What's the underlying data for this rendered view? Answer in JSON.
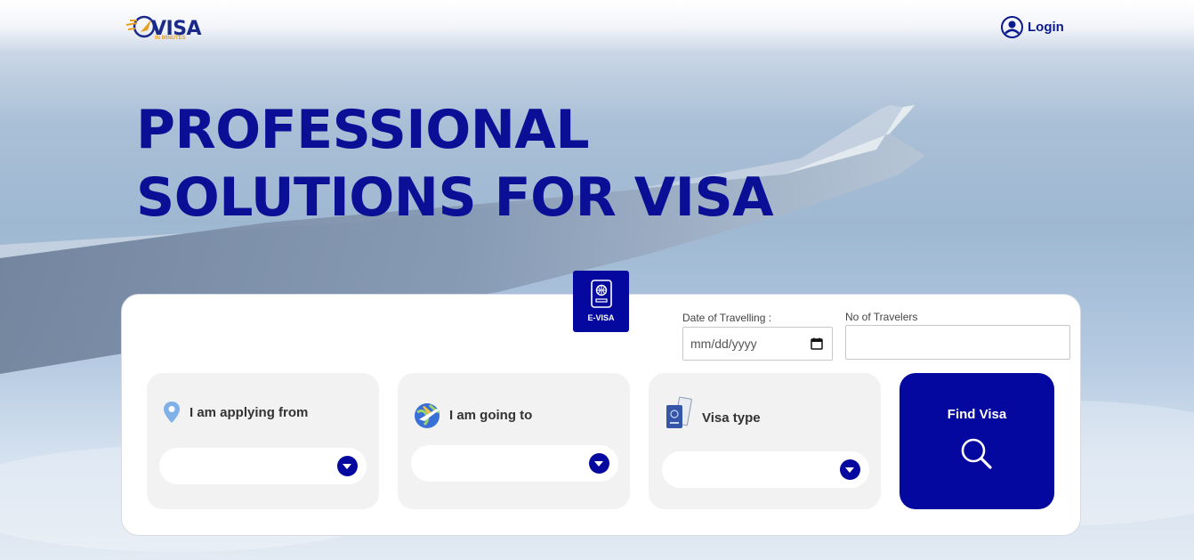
{
  "header": {
    "logo_text": "VISA",
    "logo_subtext": "IN MINUTES",
    "login_label": "Login"
  },
  "hero": {
    "line1": "PROFESSIONAL",
    "line2": "SOLUTIONS FOR VISA"
  },
  "search": {
    "tab_label": "E-VISA",
    "date_label": "Date of Travelling :",
    "date_placeholder": "mm/dd/yyyy",
    "travelers_label": "No of Travelers",
    "travelers_value": "",
    "from_label": "I am applying from",
    "from_value": "",
    "to_label": "I am going to",
    "to_value": "",
    "visa_type_label": "Visa type",
    "visa_type_value": "",
    "find_label": "Find Visa"
  },
  "colors": {
    "brand": "#05089e",
    "title": "#0a0f96",
    "accent": "#e8a020"
  },
  "icons": {
    "login": "user-circle-icon",
    "tab": "passport-icon",
    "from": "map-pin-icon",
    "to": "globe-plane-icon",
    "visa_type": "passport-documents-icon",
    "find": "search-icon",
    "date": "calendar-icon",
    "dropdown": "chevron-down-icon"
  }
}
